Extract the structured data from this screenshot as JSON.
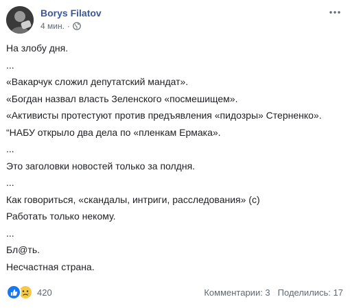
{
  "post": {
    "author": "Borys Filatov",
    "time": "4 мин.",
    "separator": "·",
    "privacy_icon": "globe-icon",
    "more_icon": "more-options-icon",
    "lines": [
      "На злобу дня.",
      "...",
      "«Вакарчук сложил депутатский мандат».",
      "«Богдан назвал власть Зеленского «посмешищем».",
      "«Активисты протестуют против предъявления «пидозры» Стерненко».",
      "“НАБУ открыло два дела по «пленкам Ермака».",
      "...",
      "Это заголовки новостей только за полдня.",
      "...",
      "Как говориться, «скандалы, интриги, расследования» (с)",
      "Работать только некому.",
      "...",
      "Бл@ть.",
      "Несчастная страна."
    ]
  },
  "footer": {
    "reaction_icons": [
      "like-icon",
      "sad-icon"
    ],
    "reaction_count": "420",
    "comments": "Комментарии: 3",
    "shares": "Поделились: 17"
  },
  "colors": {
    "author": "#385898",
    "meta": "#616770",
    "text": "#1c1e21",
    "like": "#1877f2",
    "sad": "#f7c94a"
  }
}
